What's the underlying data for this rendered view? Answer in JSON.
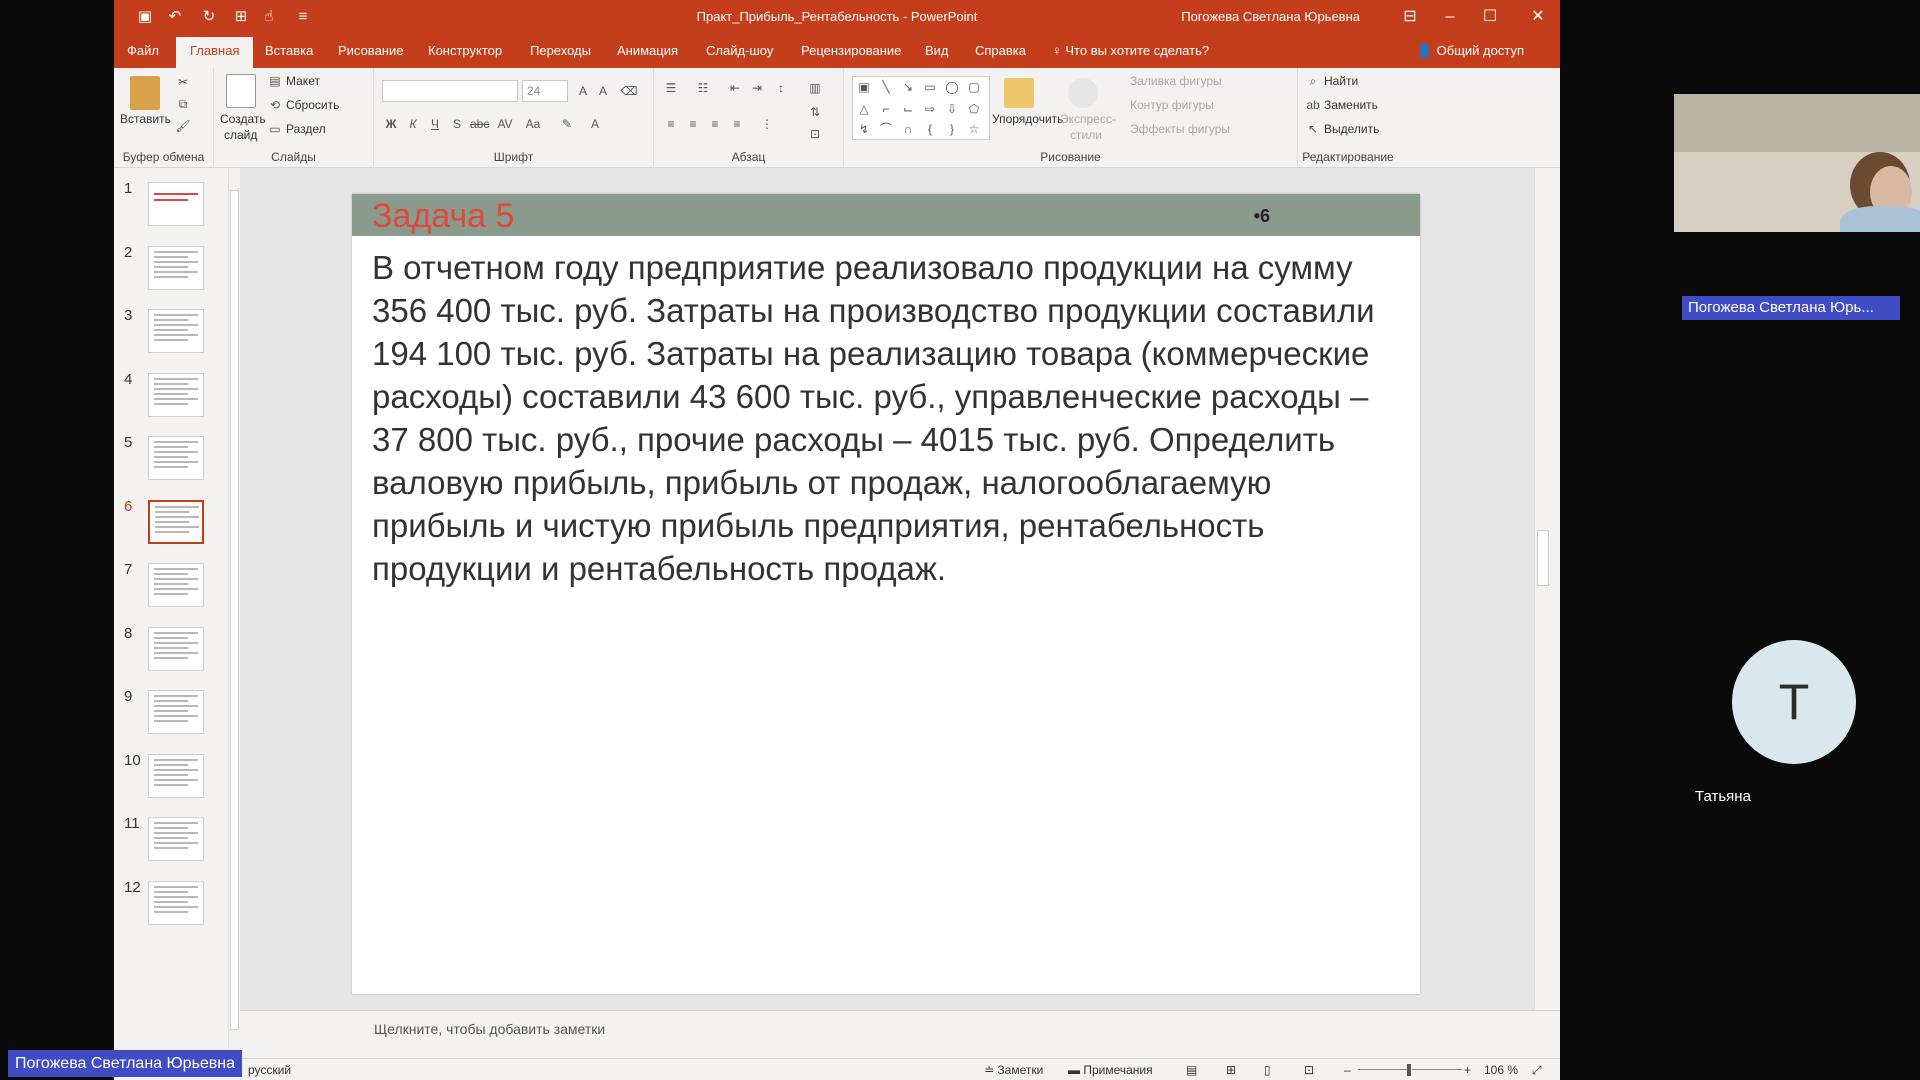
{
  "window": {
    "title": "Практ_Прибыль_Рентабельность  -  PowerPoint",
    "user": "Погожева Светлана Юрьевна"
  },
  "tabs": [
    {
      "label": "Файл"
    },
    {
      "label": "Главная"
    },
    {
      "label": "Вставка"
    },
    {
      "label": "Рисование"
    },
    {
      "label": "Конструктор"
    },
    {
      "label": "Переходы"
    },
    {
      "label": "Анимация"
    },
    {
      "label": "Слайд-шоу"
    },
    {
      "label": "Рецензирование"
    },
    {
      "label": "Вид"
    },
    {
      "label": "Справка"
    },
    {
      "label": "Что вы хотите сделать?"
    }
  ],
  "share_label": "Общий доступ",
  "ribbon": {
    "clipboard": {
      "paste": "Вставить",
      "group": "Буфер обмена"
    },
    "slides": {
      "create": "Создать",
      "create2": "слайд",
      "layout": "Макет",
      "reset": "Сбросить",
      "section": "Раздел",
      "group": "Слайды"
    },
    "font": {
      "size": "24",
      "group": "Шрифт"
    },
    "paragraph": {
      "group": "Абзац"
    },
    "drawing": {
      "arrange": "Упорядочить",
      "express": "Экспресс-",
      "express2": "стили",
      "fill": "Заливка фигуры",
      "outline": "Контур фигуры",
      "effects": "Эффекты фигуры",
      "group": "Рисование"
    },
    "editing": {
      "find": "Найти",
      "replace": "Заменить",
      "select": "Выделить",
      "group": "Редактирование"
    }
  },
  "thumbnails": [
    "1",
    "2",
    "3",
    "4",
    "5",
    "6",
    "7",
    "8",
    "9",
    "10",
    "11",
    "12"
  ],
  "slide": {
    "title": "Задача 5",
    "number": "•6",
    "body": "В отчетном году предприятие реализовало продукции на сумму 356 400 тыс. руб. Затраты на производство продукции составили 194 100 тыс. руб. Затраты на реализацию товара (коммерческие расходы) составили 43 600 тыс. руб., управленческие расходы – 37 800 тыс. руб., прочие расходы – 4015 тыс. руб. Определить валовую прибыль, прибыль от продаж, налогооблагаемую прибыль и чистую прибыль предприятия, рентабельность продукции и рентабельность продаж."
  },
  "notes_placeholder": "Щелкните, чтобы добавить заметки",
  "status": {
    "language": "русский",
    "notes": "Заметки",
    "comments": "Примечания",
    "zoom": "106 %"
  },
  "call": {
    "camera_name": "Погожева Светлана Юрь...",
    "avatar_letter": "Т",
    "avatar_name": "Татьяна",
    "presenter": "Погожева Светлана Юрьевна"
  },
  "colors": {
    "accent": "#c43e1c",
    "slide_header": "#8a9b8e",
    "title_red": "#e04a3a",
    "badge": "#3f4cc3"
  }
}
